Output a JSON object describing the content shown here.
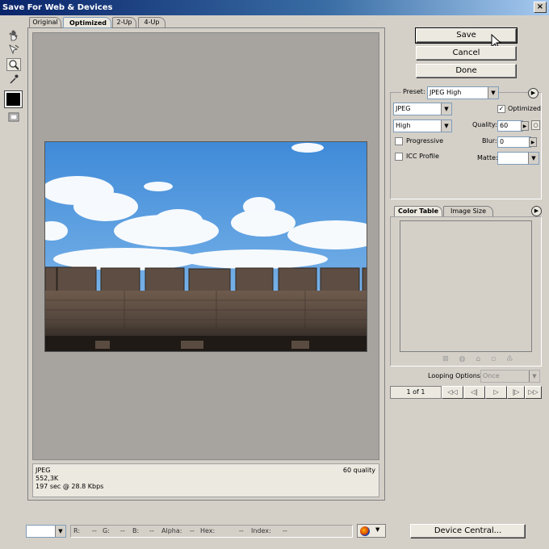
{
  "window": {
    "title": "Save For Web & Devices",
    "close_glyph": "×"
  },
  "tools": {
    "hand": "hand-tool",
    "slice": "slice-select-tool",
    "zoom": "zoom-tool",
    "eyedropper": "eyedropper-tool",
    "color": "#000000",
    "toggle": "toggle-slices"
  },
  "tabs": [
    {
      "label": "Original"
    },
    {
      "label": "Optimized"
    },
    {
      "label": "2-Up"
    },
    {
      "label": "4-Up"
    }
  ],
  "actions": {
    "save": "Save",
    "cancel": "Cancel",
    "done": "Done"
  },
  "settings": {
    "preset_label": "Preset:",
    "preset_value": "JPEG High",
    "format": "JPEG",
    "quality_preset": "High",
    "optimized_label": "Optimized",
    "optimized_checked": "✓",
    "quality_label": "Quality:",
    "quality_value": "60",
    "progressive_label": "Progressive",
    "blur_label": "Blur:",
    "blur_value": "0",
    "icc_label": "ICC Profile",
    "matte_label": "Matte:"
  },
  "color_panel": {
    "tab_color": "Color Table",
    "tab_size": "Image Size"
  },
  "animation": {
    "looping_label": "Looping Options:",
    "looping_value": "Once",
    "frame": "1 of 1"
  },
  "info": {
    "format": "JPEG",
    "size": "552,3K",
    "time": "197 sec @ 28.8 Kbps",
    "quality": "60 quality"
  },
  "statusbar": {
    "r_label": "R:",
    "r_val": "--",
    "g_label": "G:",
    "g_val": "--",
    "b_label": "B:",
    "b_val": "--",
    "alpha_label": "Alpha:",
    "alpha_val": "--",
    "hex_label": "Hex:",
    "hex_val": "--",
    "index_label": "Index:",
    "index_val": "--",
    "device_central": "Device Central..."
  }
}
